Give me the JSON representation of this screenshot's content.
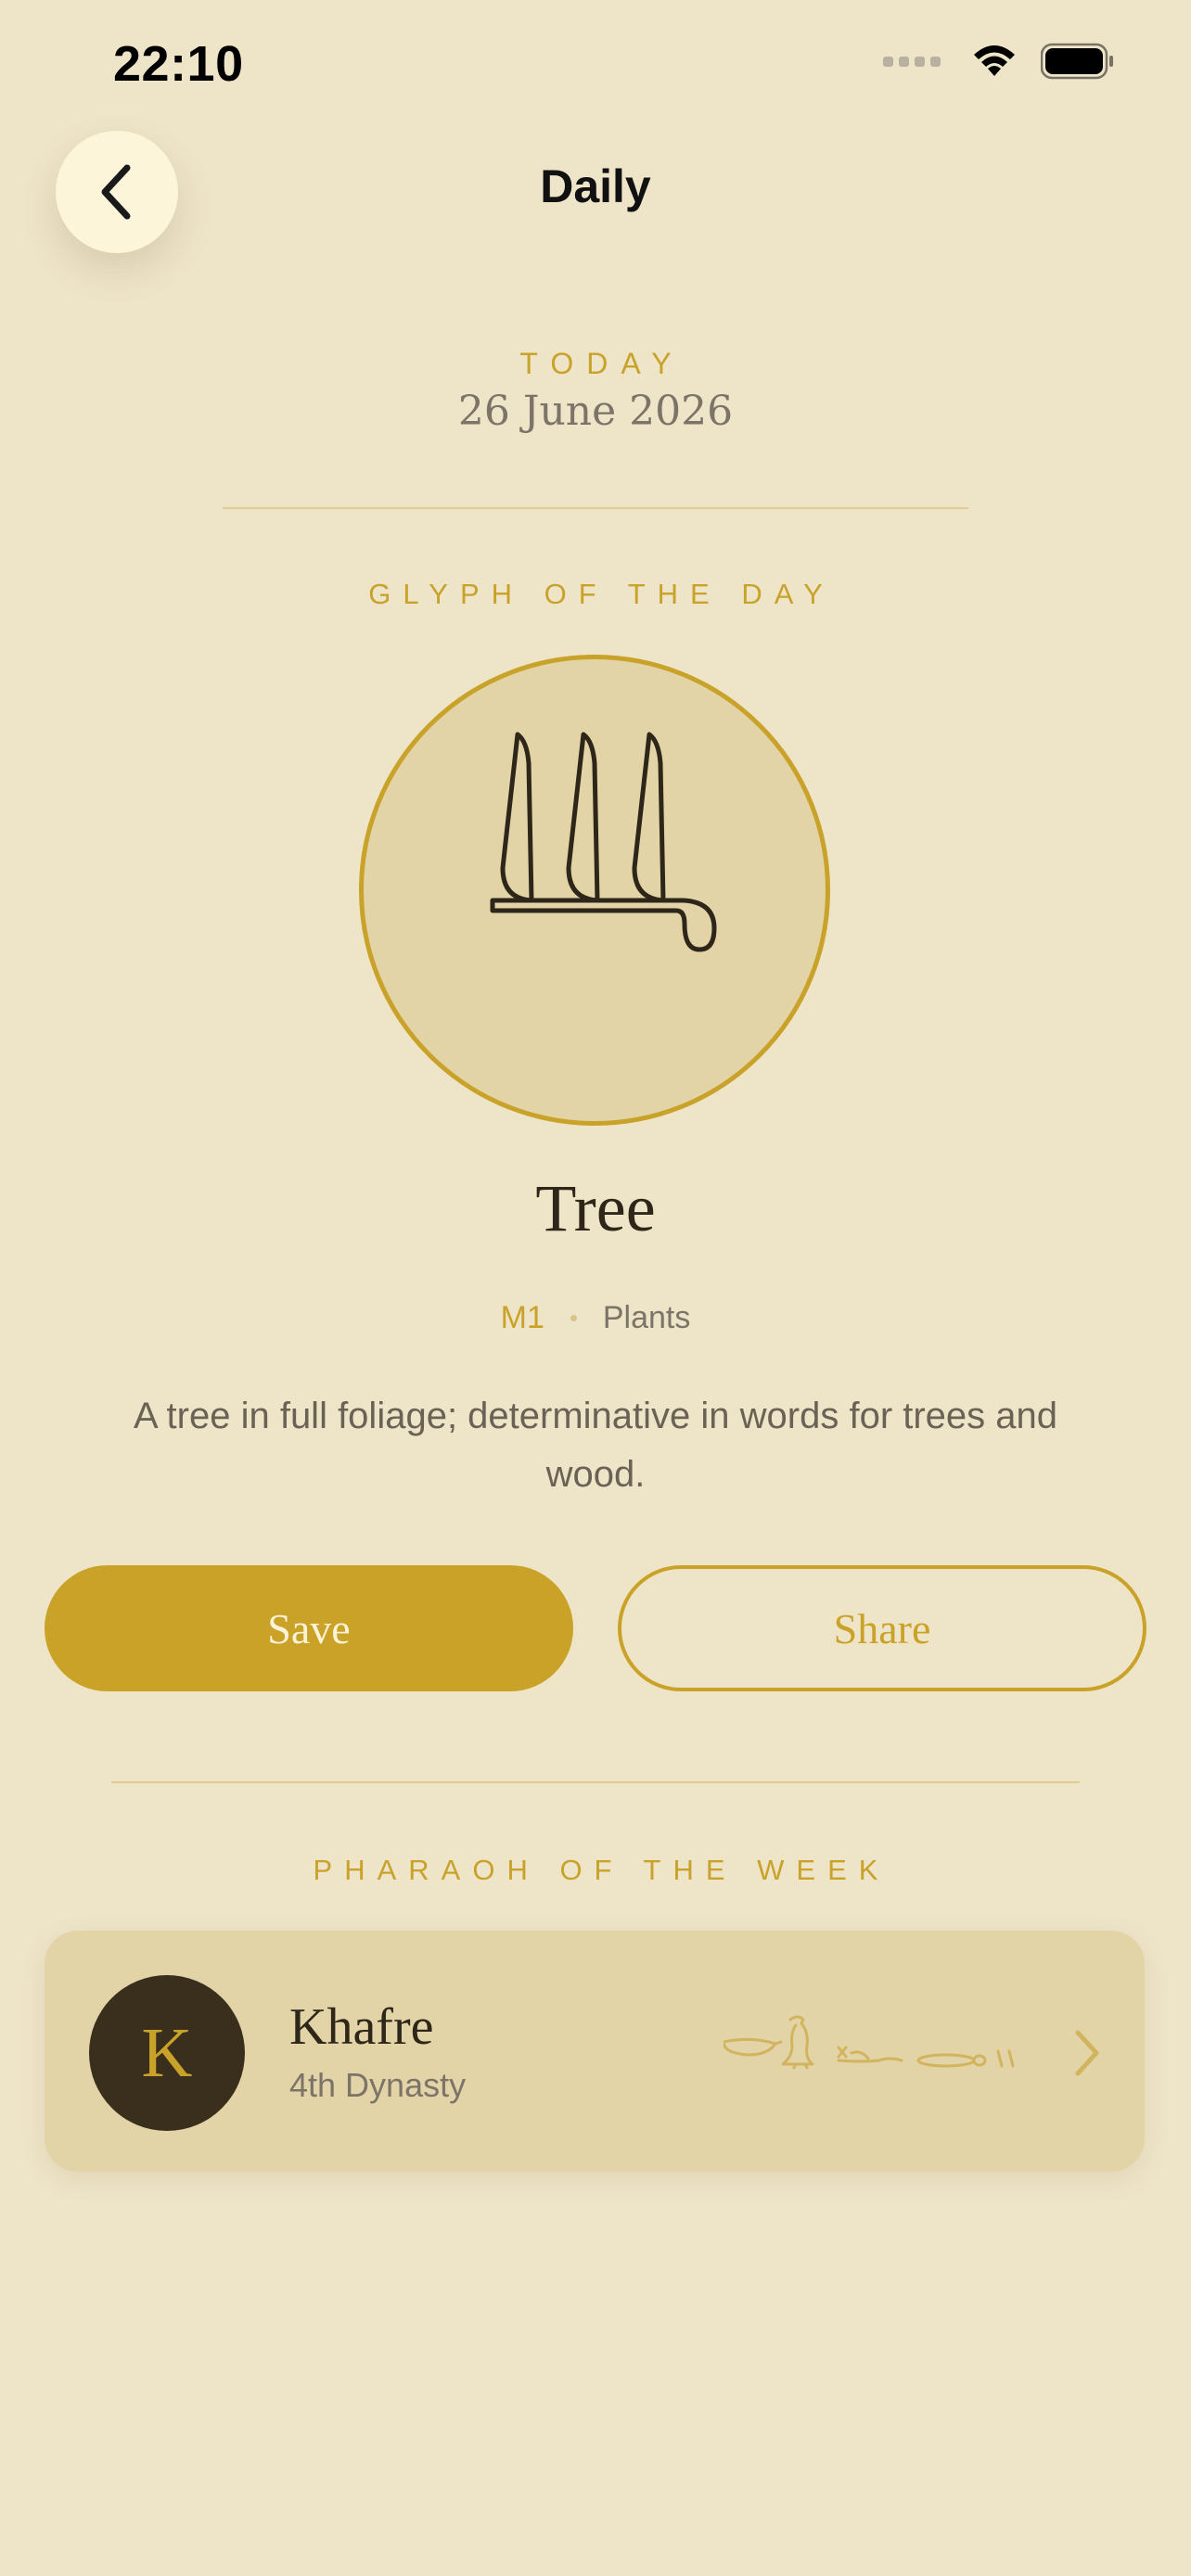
{
  "status_bar": {
    "time": "22:10"
  },
  "nav": {
    "title": "Daily",
    "back_icon": "chevron-left-icon"
  },
  "today": {
    "label": "TODAY",
    "date": "26 June 2026"
  },
  "glyph_of_day": {
    "section_label": "GLYPH OF THE DAY",
    "name": "Tree",
    "code": "M1",
    "category": "Plants",
    "description": "A tree in full foliage; determinative in words for trees and wood.",
    "icon": "tree-hieroglyph-icon"
  },
  "actions": {
    "save_label": "Save",
    "share_label": "Share"
  },
  "pharaoh_of_week": {
    "section_label": "PHARAOH OF THE WEEK",
    "avatar_initial": "K",
    "name": "Khafre",
    "dynasty": "4th Dynasty"
  },
  "colors": {
    "background": "#EEE4C8",
    "accent_gold": "#C9A227",
    "card": "#E3D4A8",
    "dark_brown": "#3A2E1C"
  }
}
